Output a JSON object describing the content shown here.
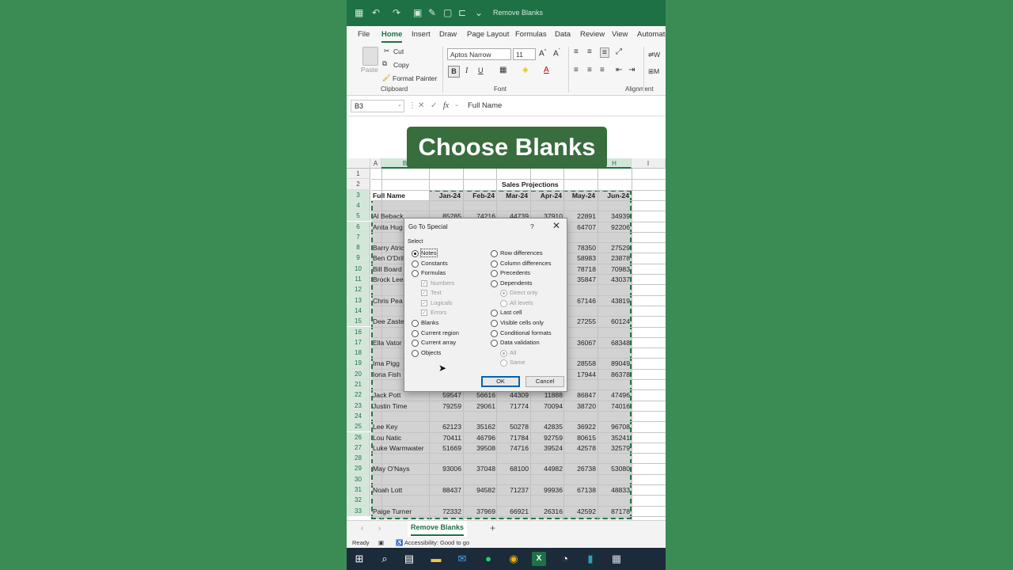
{
  "window": {
    "document_title": "Remove Blanks"
  },
  "menu": [
    "File",
    "Home",
    "Insert",
    "Draw",
    "Page Layout",
    "Formulas",
    "Data",
    "Review",
    "View",
    "Automate"
  ],
  "ribbon": {
    "paste": "Paste",
    "cut": "Cut",
    "copy": "Copy",
    "format_painter": "Format Painter",
    "clipboard": "Clipboard",
    "font_name": "Aptos Narrow",
    "font_size": "11",
    "font_group": "Font",
    "alignment_group": "Alignment",
    "bold": "B",
    "italic": "I",
    "underline": "U",
    "grow_font": "A^",
    "shrink_font": "Aˇ",
    "wrap_partial": "W",
    "merge_partial": "M"
  },
  "formula_bar": {
    "name_box": "B3",
    "fx": "fx",
    "value": "Full Name"
  },
  "caption": "Choose Blanks",
  "columns": [
    "A",
    "B",
    "C",
    "D",
    "E",
    "F",
    "G",
    "H",
    "I"
  ],
  "rows": [
    "1",
    "2",
    "3",
    "4",
    "5",
    "6",
    "7",
    "8",
    "9",
    "10",
    "11",
    "12",
    "13",
    "14",
    "15",
    "16",
    "17",
    "18",
    "19",
    "20",
    "21",
    "22",
    "23",
    "24",
    "25",
    "26",
    "27",
    "28",
    "29",
    "30",
    "31",
    "32",
    "33"
  ],
  "sheet": {
    "title": "Sales Projections",
    "headers": [
      "Full Name",
      "Jan-24",
      "Feb-24",
      "Mar-24",
      "Apr-24",
      "May-24",
      "Jun-24"
    ],
    "names": [
      {
        "row": 5,
        "name": "Al Beback"
      },
      {
        "row": 6,
        "name": "Anita Hug"
      },
      {
        "row": 8,
        "name": "Barry Atric"
      },
      {
        "row": 9,
        "name": "Ben O'Dril"
      },
      {
        "row": 10,
        "name": "Bill Board"
      },
      {
        "row": 11,
        "name": "Brock Lee"
      },
      {
        "row": 13,
        "name": "Chris Pea"
      },
      {
        "row": 15,
        "name": "Dee Zaste"
      },
      {
        "row": 17,
        "name": "Ella Vator"
      },
      {
        "row": 19,
        "name": "Ima Pigg"
      },
      {
        "row": 20,
        "name": "Iona Fish"
      },
      {
        "row": 22,
        "name": "Jack Pott"
      },
      {
        "row": 23,
        "name": "Justin Time"
      },
      {
        "row": 25,
        "name": "Lee Key"
      },
      {
        "row": 26,
        "name": "Lou Natic"
      },
      {
        "row": 27,
        "name": "Luke Warmwater"
      },
      {
        "row": 29,
        "name": "May O'Nays"
      },
      {
        "row": 31,
        "name": "Noah Lott"
      },
      {
        "row": 33,
        "name": "Paige Turner"
      }
    ],
    "values": [
      {
        "row": 5,
        "cols": [
          "85285",
          "74216",
          "44739",
          "37910",
          "22891",
          "34939"
        ]
      },
      {
        "row": 6,
        "cols": [
          "",
          "",
          "",
          "",
          "64707",
          "92206"
        ]
      },
      {
        "row": 8,
        "cols": [
          "",
          "",
          "",
          "",
          "78350",
          "27529"
        ]
      },
      {
        "row": 9,
        "cols": [
          "",
          "",
          "",
          "",
          "58983",
          "23878"
        ]
      },
      {
        "row": 10,
        "cols": [
          "",
          "",
          "",
          "",
          "78718",
          "70983"
        ]
      },
      {
        "row": 11,
        "cols": [
          "",
          "",
          "",
          "",
          "35847",
          "43037"
        ]
      },
      {
        "row": 13,
        "cols": [
          "",
          "",
          "",
          "",
          "67146",
          "43819"
        ]
      },
      {
        "row": 15,
        "cols": [
          "",
          "",
          "",
          "",
          "27255",
          "60124"
        ]
      },
      {
        "row": 17,
        "cols": [
          "",
          "",
          "",
          "",
          "36067",
          "68348"
        ]
      },
      {
        "row": 19,
        "cols": [
          "",
          "",
          "",
          "",
          "28558",
          "89049"
        ]
      },
      {
        "row": 20,
        "cols": [
          "",
          "",
          "",
          "",
          "17944",
          "86378"
        ]
      },
      {
        "row": 22,
        "cols": [
          "59547",
          "56616",
          "44309",
          "11888",
          "86847",
          "47496"
        ]
      },
      {
        "row": 23,
        "cols": [
          "79259",
          "29061",
          "71774",
          "70094",
          "38720",
          "74016"
        ]
      },
      {
        "row": 25,
        "cols": [
          "62123",
          "35162",
          "50278",
          "42835",
          "36922",
          "96708"
        ]
      },
      {
        "row": 26,
        "cols": [
          "70411",
          "46796",
          "71784",
          "92759",
          "80615",
          "35241"
        ]
      },
      {
        "row": 27,
        "cols": [
          "51669",
          "39508",
          "74716",
          "39524",
          "42578",
          "32579"
        ]
      },
      {
        "row": 29,
        "cols": [
          "93006",
          "37048",
          "68100",
          "44982",
          "26738",
          "53080"
        ]
      },
      {
        "row": 31,
        "cols": [
          "88437",
          "94582",
          "71237",
          "99936",
          "67138",
          "48833"
        ]
      },
      {
        "row": 33,
        "cols": [
          "72332",
          "37969",
          "66921",
          "26316",
          "42592",
          "87178"
        ]
      }
    ]
  },
  "dialog": {
    "title": "Go To Special",
    "help": "?",
    "close": "✕",
    "select_label": "Select",
    "left_options": [
      "Notes",
      "Constants",
      "Formulas",
      "Numbers",
      "Text",
      "Logicals",
      "Errors",
      "Blanks",
      "Current region",
      "Current array",
      "Objects"
    ],
    "right_options": [
      "Row differences",
      "Column differences",
      "Precedents",
      "Dependents",
      "Direct only",
      "All levels",
      "Last cell",
      "Visible cells only",
      "Conditional formats",
      "Data validation",
      "All",
      "Same"
    ],
    "ok": "OK",
    "cancel": "Cancel"
  },
  "sheet_tab": "Remove Blanks",
  "status": {
    "ready": "Ready",
    "accessibility": "Accessibility: Good to go"
  },
  "icons": {
    "excel": "excel-icon",
    "undo": "undo-icon",
    "redo": "redo-icon",
    "save": "save-icon",
    "windows": "windows-start-icon",
    "search": "search-icon",
    "taskview": "task-view-icon",
    "explorer": "file-explorer-icon",
    "mail": "mail-icon",
    "spotify": "spotify-icon",
    "chrome": "chrome-icon",
    "excel_task": "excel-taskbar-icon",
    "recorder": "recorder-icon",
    "app": "app-icon",
    "calculator": "calculator-icon"
  },
  "colors": {
    "excel_green": "#1e7145",
    "background": "#3b8b54",
    "caption_bg": "#386d3d"
  }
}
